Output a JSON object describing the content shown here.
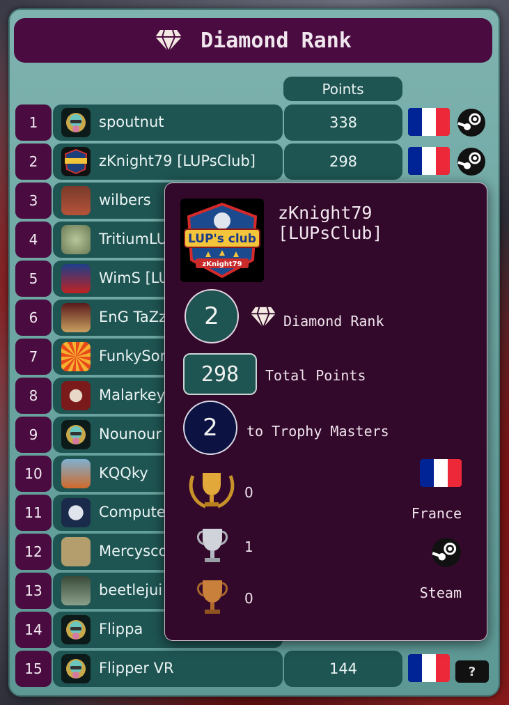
{
  "header": {
    "title": "Diamond Rank",
    "icon": "diamond-icon"
  },
  "table": {
    "points_header": "Points",
    "rows": [
      {
        "rank": "1",
        "name": "spoutnut",
        "points": "338",
        "flag": "France",
        "platform": "steam"
      },
      {
        "rank": "2",
        "name": "zKnight79 [LUPsClub]",
        "points": "298",
        "flag": "France",
        "platform": "steam"
      },
      {
        "rank": "3",
        "name": "wilbers"
      },
      {
        "rank": "4",
        "name": "TritiumLU"
      },
      {
        "rank": "5",
        "name": "WimS [LU"
      },
      {
        "rank": "6",
        "name": "EnG TaZz"
      },
      {
        "rank": "7",
        "name": "FunkySor"
      },
      {
        "rank": "8",
        "name": "Malarkey"
      },
      {
        "rank": "9",
        "name": "Nounour"
      },
      {
        "rank": "10",
        "name": "KQQky"
      },
      {
        "rank": "11",
        "name": "Compute"
      },
      {
        "rank": "12",
        "name": "Mercysco"
      },
      {
        "rank": "13",
        "name": "beetlejui"
      },
      {
        "rank": "14",
        "name": "Flippa"
      },
      {
        "rank": "15",
        "name": "Flipper VR",
        "points": "144",
        "flag": "France",
        "platform": "?"
      }
    ]
  },
  "popup": {
    "name_line1": "zKnight79",
    "name_line2": "[LUPsClub]",
    "avatar_logo_text": "LUP's club",
    "avatar_logo_subtext": "zKnight79",
    "rank": "2",
    "rank_label": "Diamond Rank",
    "points": "298",
    "points_label": "Total Points",
    "to_next": "2",
    "to_next_label": "to Trophy Masters",
    "gold": "0",
    "silver": "1",
    "bronze": "0",
    "country": "France",
    "platform": "Steam"
  },
  "colors": {
    "panel": "#6ea7a3",
    "header_bg": "#4a0c40",
    "cell_bg": "#1e5452",
    "popup_bg": "#33092b",
    "flag_blue": "#002395",
    "flag_white": "#ffffff",
    "flag_red": "#ed2939"
  }
}
